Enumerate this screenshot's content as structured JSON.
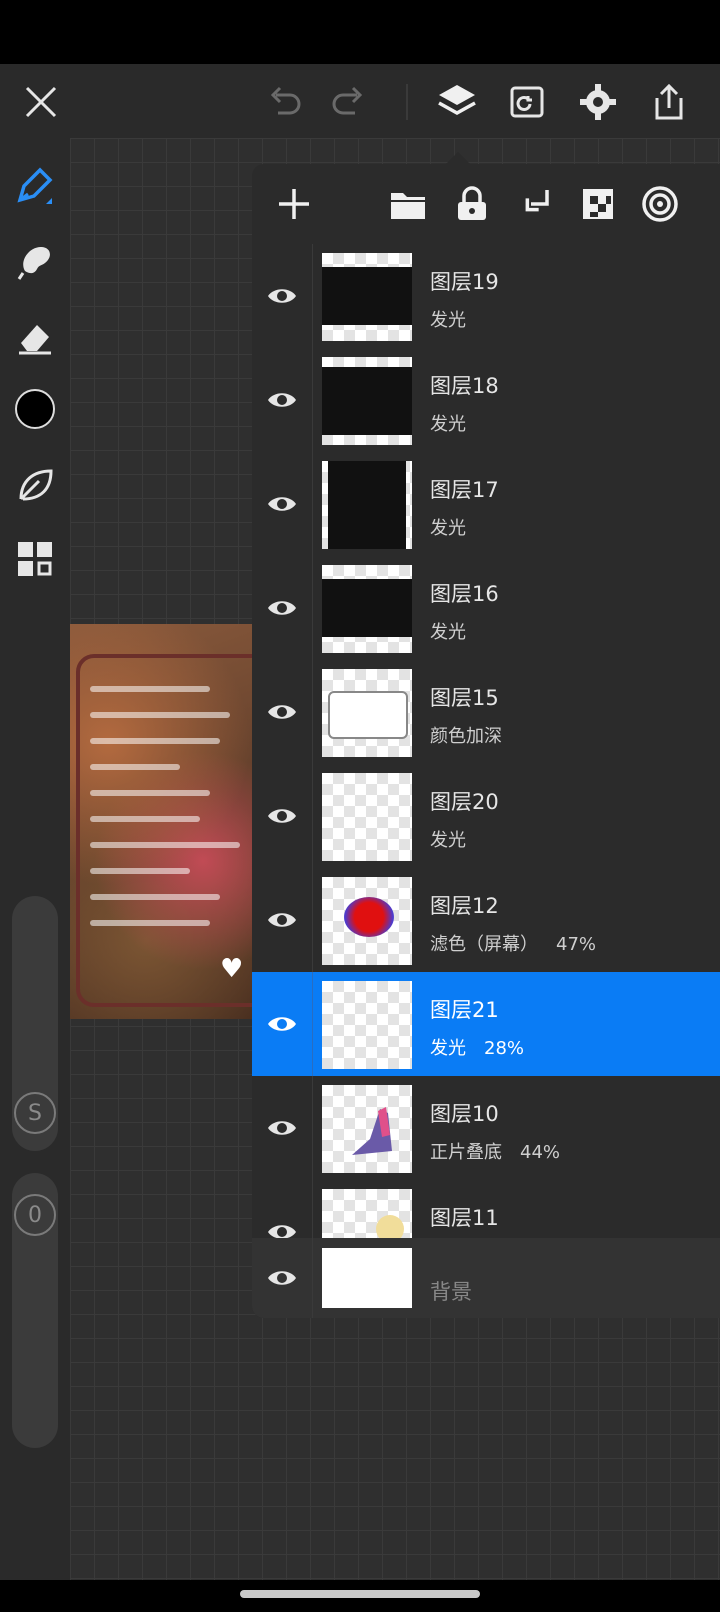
{
  "layers_panel": {
    "layers": [
      {
        "name": "图层19",
        "mode": "发光",
        "opacity": ""
      },
      {
        "name": "图层18",
        "mode": "发光",
        "opacity": ""
      },
      {
        "name": "图层17",
        "mode": "发光",
        "opacity": ""
      },
      {
        "name": "图层16",
        "mode": "发光",
        "opacity": ""
      },
      {
        "name": "图层15",
        "mode": "颜色加深",
        "opacity": ""
      },
      {
        "name": "图层20",
        "mode": "发光",
        "opacity": ""
      },
      {
        "name": "图层12",
        "mode": "滤色（屏幕）",
        "opacity": "47%"
      },
      {
        "name": "图层21",
        "mode": "发光",
        "opacity": "28%"
      },
      {
        "name": "图层10",
        "mode": "正片叠底",
        "opacity": "44%"
      },
      {
        "name": "图层11",
        "mode": "",
        "opacity": ""
      }
    ],
    "selected_layer": "图层21",
    "background_layer": {
      "name": "背景"
    }
  },
  "toolbar": {
    "size_slider_label": "S",
    "opacity_slider_label": "0",
    "color": "#000000"
  },
  "colors": {
    "accent": "#0a7cf5",
    "panel": "#2b2b2b",
    "toolbar": "#2a2a2a"
  }
}
